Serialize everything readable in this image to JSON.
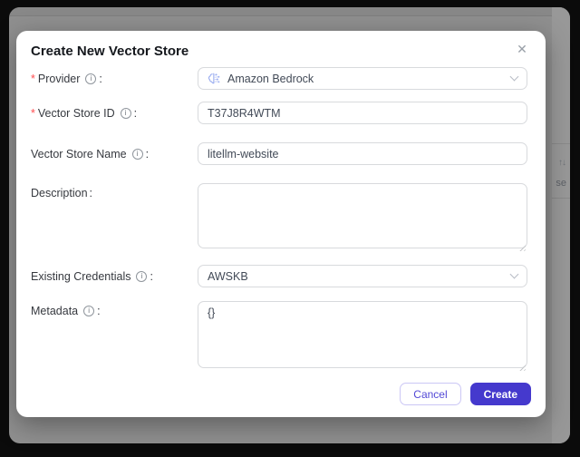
{
  "colors": {
    "accent": "#4539cd",
    "required_mark": "#ff4d4f",
    "overlay": "#8f8f8f",
    "frame": "#0b0b0b"
  },
  "icons": {
    "close": "✕",
    "info": "i",
    "chevron_down": "∨",
    "provider_logo": "bedrock-icon",
    "sort": "↑↓",
    "resize_grip": "◢"
  },
  "background": {
    "sort_icon": "↑↓",
    "clipped_text": "se"
  },
  "modal": {
    "title": "Create New Vector Store",
    "required_mark": "*",
    "colon": ":",
    "fields": [
      {
        "key": "provider",
        "label": "Provider",
        "required": true,
        "has_info": true,
        "type": "select",
        "value": "Amazon Bedrock",
        "has_icon": true
      },
      {
        "key": "vector_store_id",
        "label": "Vector Store ID",
        "required": true,
        "has_info": true,
        "type": "input",
        "value": "T37J8R4WTM"
      },
      {
        "key": "vector_store_name",
        "label": "Vector Store Name",
        "required": false,
        "has_info": true,
        "type": "input",
        "value": "litellm-website"
      },
      {
        "key": "description",
        "label": "Description",
        "required": false,
        "has_info": false,
        "type": "textarea",
        "value": ""
      },
      {
        "key": "existing_credentials",
        "label": "Existing Credentials",
        "required": false,
        "has_info": true,
        "type": "select",
        "value": "AWSKB"
      },
      {
        "key": "metadata",
        "label": "Metadata",
        "required": false,
        "has_info": true,
        "type": "textarea",
        "value": "{}"
      }
    ],
    "footer": {
      "cancel_label": "Cancel",
      "create_label": "Create"
    }
  }
}
